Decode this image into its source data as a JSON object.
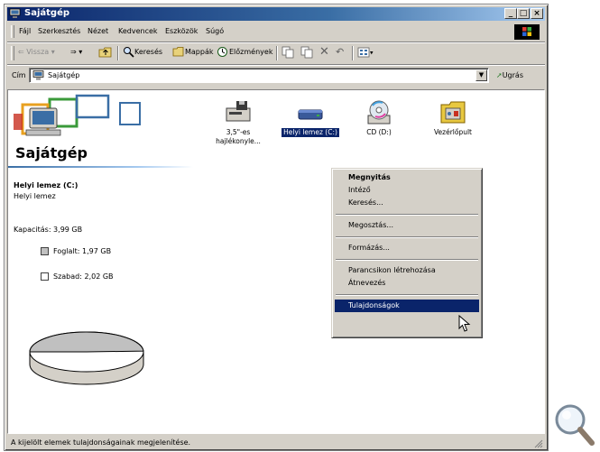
{
  "window": {
    "title": "Sajátgép"
  },
  "menubar": {
    "items": [
      "Fájl",
      "Szerkesztés",
      "Nézet",
      "Kedvencek",
      "Eszközök",
      "Súgó"
    ]
  },
  "toolbar": {
    "back": "⇐ Vissza",
    "forward": "⇒",
    "search": "Keresés",
    "folders": "Mappák",
    "history": "Előzmények"
  },
  "address": {
    "label": "Cím",
    "value": "Sajátgép",
    "go": "Ugrás"
  },
  "left_panel": {
    "title": "Sajátgép",
    "drive_name": "Helyi lemez (C:)",
    "drive_type": "Helyi lemez",
    "capacity": "Kapacitás: 3,99 GB",
    "used": "Foglalt: 1,97 GB",
    "free": "Szabad: 2,02 GB",
    "used_color": "#c0c0c0",
    "free_color": "#ffffff"
  },
  "icons": [
    {
      "label": "3,5\"-es hajlékonyle...",
      "icon": "floppy-drive-icon"
    },
    {
      "label": "Helyi lemez (C:)",
      "icon": "hard-drive-icon"
    },
    {
      "label": "CD (D:)",
      "icon": "cd-drive-icon"
    },
    {
      "label": "Vezérlőpult",
      "icon": "control-panel-icon"
    }
  ],
  "context_menu": {
    "items": [
      "Megnyitás",
      "Intéző",
      "Keresés...",
      "Megosztás...",
      "Formázás...",
      "Parancsikon létrehozása",
      "Átnevezés",
      "Tulajdonságok"
    ]
  },
  "status": {
    "text": "A kijelölt elemek tulajdonságainak megjelenítése."
  }
}
